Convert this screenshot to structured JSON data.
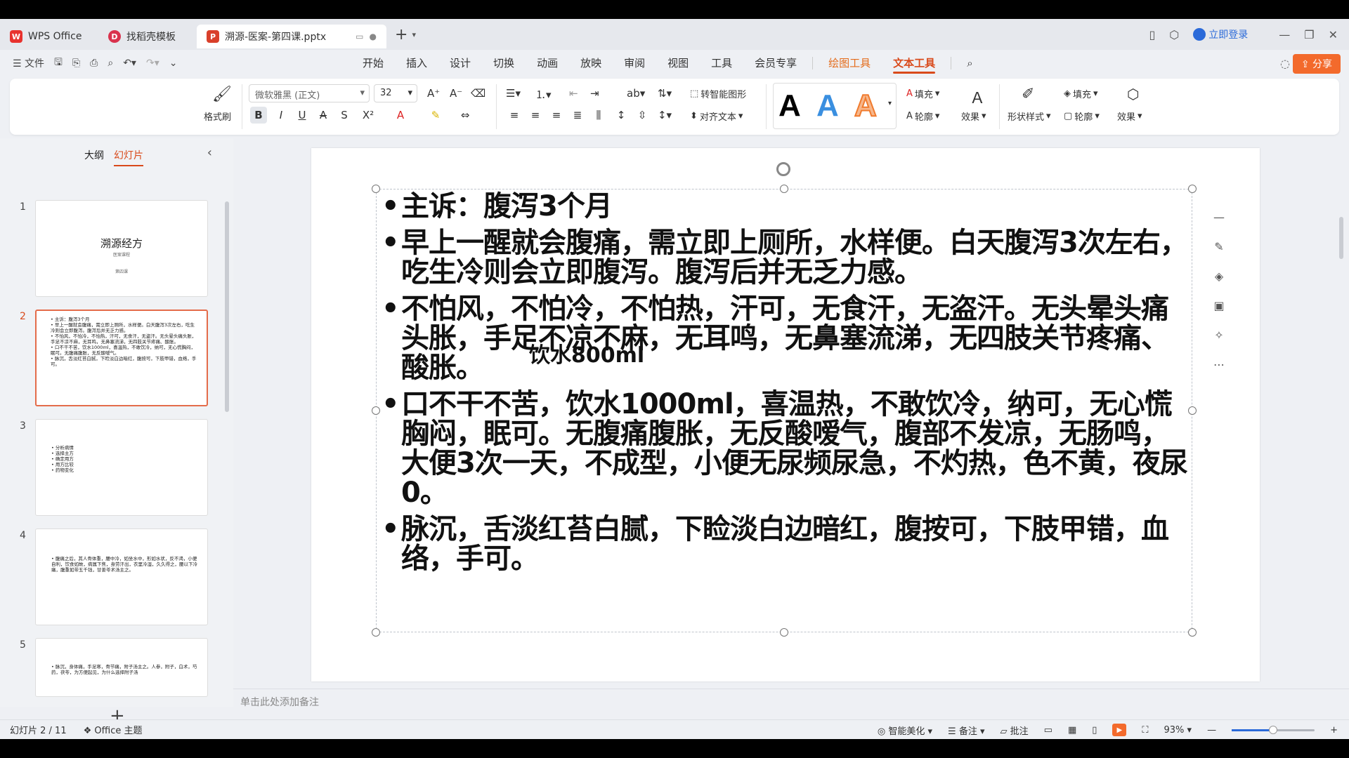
{
  "tabs": {
    "home": "WPS Office",
    "template": "找稻壳模板",
    "document": "溯源-医案-第四课.pptx",
    "login": "立即登录"
  },
  "menu": {
    "file": "文件",
    "tabs": [
      "开始",
      "插入",
      "设计",
      "切换",
      "动画",
      "放映",
      "审阅",
      "视图",
      "工具",
      "会员专享"
    ],
    "drawing_tools": "绘图工具",
    "text_tools": "文本工具",
    "share": "分享"
  },
  "ribbon": {
    "format_painter": "格式刷",
    "font_name": "微软雅黑 (正文)",
    "font_size": "32",
    "smart_shape": "转智能图形",
    "align_text": "对齐文本",
    "fill": "填充",
    "outline": "轮廓",
    "effect": "效果",
    "shape_style": "形状样式",
    "shape_fill": "填充",
    "shape_outline": "轮廓",
    "shape_effect": "效果"
  },
  "left_panel": {
    "outline_tab": "大纲",
    "slides_tab": "幻灯片",
    "slide_numbers": [
      "1",
      "2",
      "3",
      "4",
      "5"
    ],
    "thumb1_title": "溯源经方",
    "thumb1_sub1": "医案课程",
    "thumb1_sub2": "第四课",
    "thumb2_lines": "• 主诉：腹泻3个月\n• 早上一醒就会腹痛，需立即上厕所，水样便。白天腹泻3次左右，吃生冷则会立即腹泻。腹泻后并无乏力感。\n• 不怕风，不怕冷，不怕热，汗可，无食汗，无盗汗。无头晕头痛头胀，手足不凉不麻，无耳鸣，无鼻塞流涕，无四肢关节疼痛、酸胀。\n• 口不干不苦，饮水1000ml，喜温热，不敢饮冷，纳可，无心慌胸闷，眠可。无腹痛腹胀，无反酸嗳气。\n• 脉沉，舌淡红苔白腻，下睑淡白边暗红，腹按可，下肢甲错，血络，手可。",
    "thumb3_lines": "• 分析病情\n• 选择主方\n• 确定用方\n• 用方比较\n• 药物变化",
    "thumb4_lines": "• 腹痛之后，其人骨体重，腰中冷，如坐水中，形如水状，反不渴，小便自利，饮食如故，病属下焦，身劳汗出，衣里冷湿，久久得之，腰以下冷痛，腹重如带五千钱，甘姜苓术汤主之。",
    "thumb5_lines": "• 脉沉，身体痛，手足寒，骨节痛，附子汤主之。人参，附子，白术，芍药，茯苓，为方便起见，为什么选择附子汤"
  },
  "slide": {
    "bullets": [
      "主诉：腹泻3个月",
      "早上一醒就会腹痛，需立即上厕所，水样便。白天腹泻3次左右，吃生冷则会立即腹泻。腹泻后并无乏力感。",
      "不怕风，不怕冷，不怕热，汗可，无食汗，无盗汗。无头晕头痛头胀，手足不凉不麻，无耳鸣，无鼻塞流涕，无四肢关节疼痛、酸胀。",
      "口不干不苦，饮水1000ml，喜温热，不敢饮冷，纳可，无心慌胸闷，眠可。无腹痛腹胀，无反酸嗳气，腹部不发凉，无肠鸣，大便3次一天，不成型，小便无尿频尿急，不灼热，色不黄，夜尿0。",
      "脉沉，舌淡红苔白腻，下睑淡白边暗红，腹按可，下肢甲错，血络，手可。"
    ],
    "overlap_text": "饮水800ml"
  },
  "notes_placeholder": "单击此处添加备注",
  "status": {
    "slide_counter": "幻灯片 2 / 11",
    "theme": "Office 主题",
    "smart_beautify": "智能美化",
    "notes": "备注",
    "comments": "批注",
    "zoom": "93%",
    "zoom_fraction": 0.5
  },
  "colors": {
    "accent": "#d94a1b",
    "drawing_tools": "#e46c1b",
    "share": "#f36a2c",
    "link": "#2b6ad9"
  }
}
